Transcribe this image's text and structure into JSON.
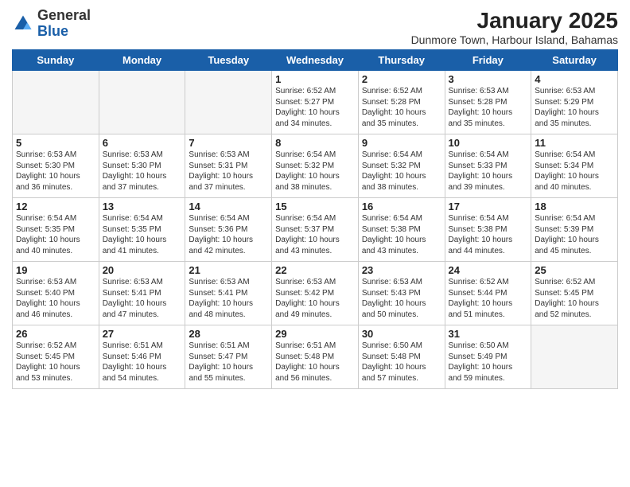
{
  "logo": {
    "general": "General",
    "blue": "Blue"
  },
  "title": "January 2025",
  "subtitle": "Dunmore Town, Harbour Island, Bahamas",
  "days_of_week": [
    "Sunday",
    "Monday",
    "Tuesday",
    "Wednesday",
    "Thursday",
    "Friday",
    "Saturday"
  ],
  "weeks": [
    [
      {
        "day": null
      },
      {
        "day": null
      },
      {
        "day": null
      },
      {
        "day": "1",
        "sunrise": "6:52 AM",
        "sunset": "5:27 PM",
        "daylight": "10 hours and 34 minutes."
      },
      {
        "day": "2",
        "sunrise": "6:52 AM",
        "sunset": "5:28 PM",
        "daylight": "10 hours and 35 minutes."
      },
      {
        "day": "3",
        "sunrise": "6:53 AM",
        "sunset": "5:28 PM",
        "daylight": "10 hours and 35 minutes."
      },
      {
        "day": "4",
        "sunrise": "6:53 AM",
        "sunset": "5:29 PM",
        "daylight": "10 hours and 35 minutes."
      }
    ],
    [
      {
        "day": "5",
        "sunrise": "6:53 AM",
        "sunset": "5:30 PM",
        "daylight": "10 hours and 36 minutes."
      },
      {
        "day": "6",
        "sunrise": "6:53 AM",
        "sunset": "5:30 PM",
        "daylight": "10 hours and 37 minutes."
      },
      {
        "day": "7",
        "sunrise": "6:53 AM",
        "sunset": "5:31 PM",
        "daylight": "10 hours and 37 minutes."
      },
      {
        "day": "8",
        "sunrise": "6:54 AM",
        "sunset": "5:32 PM",
        "daylight": "10 hours and 38 minutes."
      },
      {
        "day": "9",
        "sunrise": "6:54 AM",
        "sunset": "5:32 PM",
        "daylight": "10 hours and 38 minutes."
      },
      {
        "day": "10",
        "sunrise": "6:54 AM",
        "sunset": "5:33 PM",
        "daylight": "10 hours and 39 minutes."
      },
      {
        "day": "11",
        "sunrise": "6:54 AM",
        "sunset": "5:34 PM",
        "daylight": "10 hours and 40 minutes."
      }
    ],
    [
      {
        "day": "12",
        "sunrise": "6:54 AM",
        "sunset": "5:35 PM",
        "daylight": "10 hours and 40 minutes."
      },
      {
        "day": "13",
        "sunrise": "6:54 AM",
        "sunset": "5:35 PM",
        "daylight": "10 hours and 41 minutes."
      },
      {
        "day": "14",
        "sunrise": "6:54 AM",
        "sunset": "5:36 PM",
        "daylight": "10 hours and 42 minutes."
      },
      {
        "day": "15",
        "sunrise": "6:54 AM",
        "sunset": "5:37 PM",
        "daylight": "10 hours and 43 minutes."
      },
      {
        "day": "16",
        "sunrise": "6:54 AM",
        "sunset": "5:38 PM",
        "daylight": "10 hours and 43 minutes."
      },
      {
        "day": "17",
        "sunrise": "6:54 AM",
        "sunset": "5:38 PM",
        "daylight": "10 hours and 44 minutes."
      },
      {
        "day": "18",
        "sunrise": "6:54 AM",
        "sunset": "5:39 PM",
        "daylight": "10 hours and 45 minutes."
      }
    ],
    [
      {
        "day": "19",
        "sunrise": "6:53 AM",
        "sunset": "5:40 PM",
        "daylight": "10 hours and 46 minutes."
      },
      {
        "day": "20",
        "sunrise": "6:53 AM",
        "sunset": "5:41 PM",
        "daylight": "10 hours and 47 minutes."
      },
      {
        "day": "21",
        "sunrise": "6:53 AM",
        "sunset": "5:41 PM",
        "daylight": "10 hours and 48 minutes."
      },
      {
        "day": "22",
        "sunrise": "6:53 AM",
        "sunset": "5:42 PM",
        "daylight": "10 hours and 49 minutes."
      },
      {
        "day": "23",
        "sunrise": "6:53 AM",
        "sunset": "5:43 PM",
        "daylight": "10 hours and 50 minutes."
      },
      {
        "day": "24",
        "sunrise": "6:52 AM",
        "sunset": "5:44 PM",
        "daylight": "10 hours and 51 minutes."
      },
      {
        "day": "25",
        "sunrise": "6:52 AM",
        "sunset": "5:45 PM",
        "daylight": "10 hours and 52 minutes."
      }
    ],
    [
      {
        "day": "26",
        "sunrise": "6:52 AM",
        "sunset": "5:45 PM",
        "daylight": "10 hours and 53 minutes."
      },
      {
        "day": "27",
        "sunrise": "6:51 AM",
        "sunset": "5:46 PM",
        "daylight": "10 hours and 54 minutes."
      },
      {
        "day": "28",
        "sunrise": "6:51 AM",
        "sunset": "5:47 PM",
        "daylight": "10 hours and 55 minutes."
      },
      {
        "day": "29",
        "sunrise": "6:51 AM",
        "sunset": "5:48 PM",
        "daylight": "10 hours and 56 minutes."
      },
      {
        "day": "30",
        "sunrise": "6:50 AM",
        "sunset": "5:48 PM",
        "daylight": "10 hours and 57 minutes."
      },
      {
        "day": "31",
        "sunrise": "6:50 AM",
        "sunset": "5:49 PM",
        "daylight": "10 hours and 59 minutes."
      },
      {
        "day": null
      }
    ]
  ]
}
